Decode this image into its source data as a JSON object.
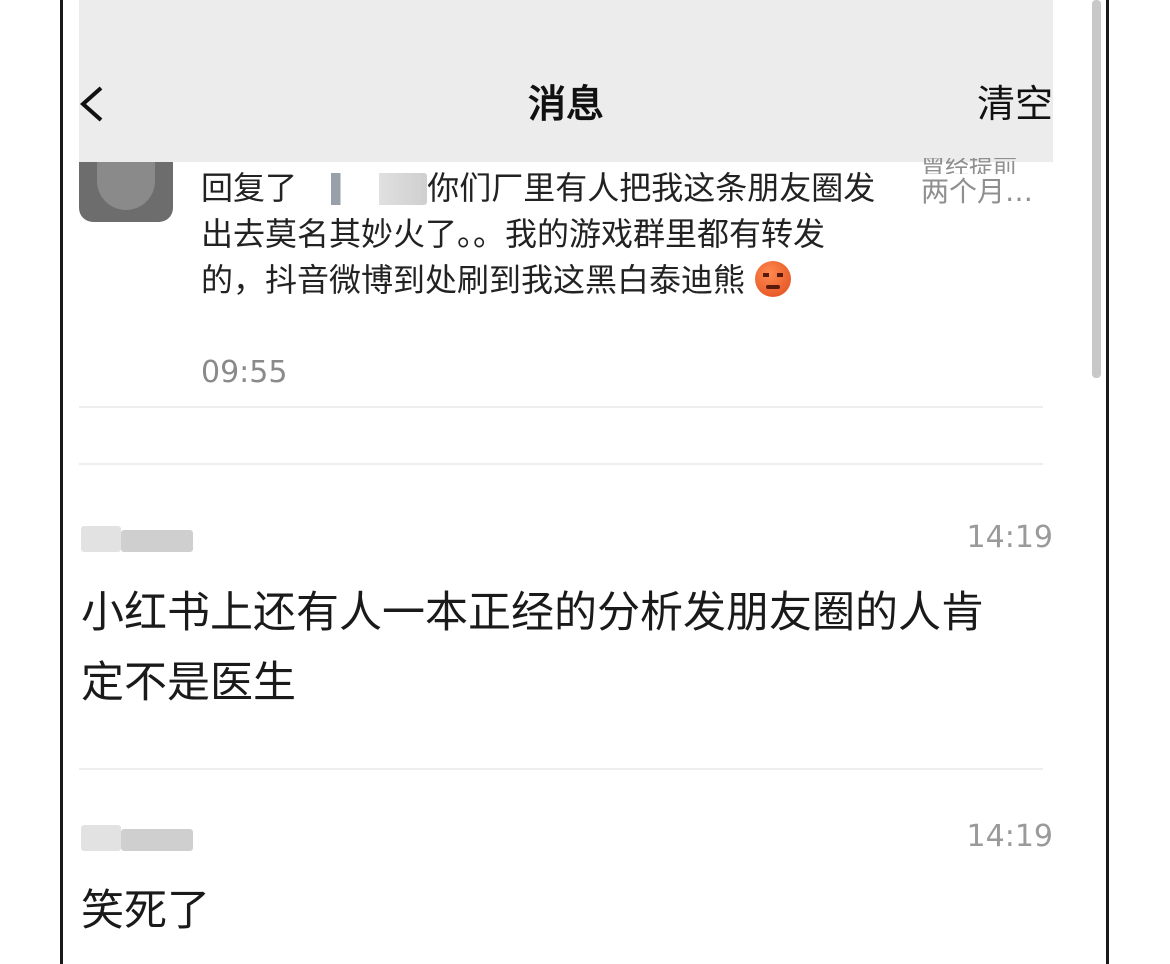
{
  "header": {
    "title": "消息",
    "action_label": "清空"
  },
  "reply": {
    "prefix": "回复了",
    "text": "你们厂里有人把我这条朋友圈发出去莫名其妙火了。。我的游戏群里都有转发的，抖音微博到处刷到我这黑白泰迪熊",
    "emoji": "angry-face",
    "time": "09:55",
    "side_preview_line1": "曾经提前",
    "side_preview_line2": "两个月…"
  },
  "messages": [
    {
      "time": "14:19",
      "body": "小红书上还有人一本正经的分析发朋友圈的人肯定不是医生"
    },
    {
      "time": "14:19",
      "body": "笑死了"
    }
  ],
  "colors": {
    "header_bg": "#ececec",
    "secondary_text": "#8a8a8a",
    "primary_text": "#1a1a1a"
  }
}
